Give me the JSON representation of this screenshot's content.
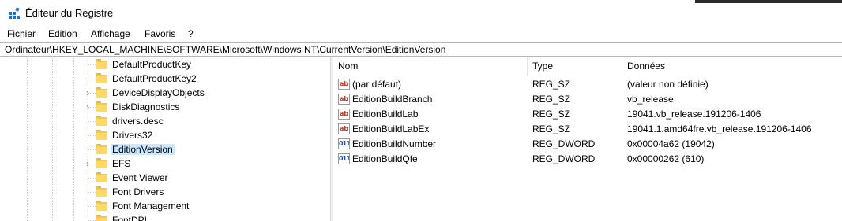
{
  "window": {
    "title": "Éditeur du Registre",
    "app_icon": "registry-editor-icon"
  },
  "menu": [
    "Fichier",
    "Edition",
    "Affichage",
    "Favoris",
    "?"
  ],
  "address": "Ordinateur\\HKEY_LOCAL_MACHINE\\SOFTWARE\\Microsoft\\Windows NT\\CurrentVersion\\EditionVersion",
  "tree": {
    "items": [
      {
        "label": "DefaultProductKey",
        "expandable": false,
        "selected": false
      },
      {
        "label": "DefaultProductKey2",
        "expandable": false,
        "selected": false
      },
      {
        "label": "DeviceDisplayObjects",
        "expandable": true,
        "selected": false
      },
      {
        "label": "DiskDiagnostics",
        "expandable": true,
        "selected": false
      },
      {
        "label": "drivers.desc",
        "expandable": false,
        "selected": false
      },
      {
        "label": "Drivers32",
        "expandable": false,
        "selected": false
      },
      {
        "label": "EditionVersion",
        "expandable": false,
        "selected": true
      },
      {
        "label": "EFS",
        "expandable": true,
        "selected": false
      },
      {
        "label": "Event Viewer",
        "expandable": false,
        "selected": false
      },
      {
        "label": "Font Drivers",
        "expandable": false,
        "selected": false
      },
      {
        "label": "Font Management",
        "expandable": false,
        "selected": false
      },
      {
        "label": "FontDPI",
        "expandable": false,
        "selected": false
      }
    ],
    "folder_icon": "folder-icon",
    "expander_icon": "chevron-right-icon"
  },
  "values": {
    "columns": {
      "name": "Nom",
      "type": "Type",
      "data": "Données"
    },
    "rows": [
      {
        "icon": "string-value-icon",
        "name": "(par défaut)",
        "type": "REG_SZ",
        "data": "(valeur non définie)"
      },
      {
        "icon": "string-value-icon",
        "name": "EditionBuildBranch",
        "type": "REG_SZ",
        "data": "vb_release"
      },
      {
        "icon": "string-value-icon",
        "name": "EditionBuildLab",
        "type": "REG_SZ",
        "data": "19041.vb_release.191206-1406"
      },
      {
        "icon": "string-value-icon",
        "name": "EditionBuildLabEx",
        "type": "REG_SZ",
        "data": "19041.1.amd64fre.vb_release.191206-1406"
      },
      {
        "icon": "dword-value-icon",
        "name": "EditionBuildNumber",
        "type": "REG_DWORD",
        "data": "0x00004a62 (19042)"
      },
      {
        "icon": "dword-value-icon",
        "name": "EditionBuildQfe",
        "type": "REG_DWORD",
        "data": "0x00000262 (610)"
      }
    ]
  },
  "colors": {
    "selection": "#cce8ff",
    "folder": "#ffd968",
    "string_icon": "#c0392b",
    "dword_icon": "#1f4e9c"
  }
}
